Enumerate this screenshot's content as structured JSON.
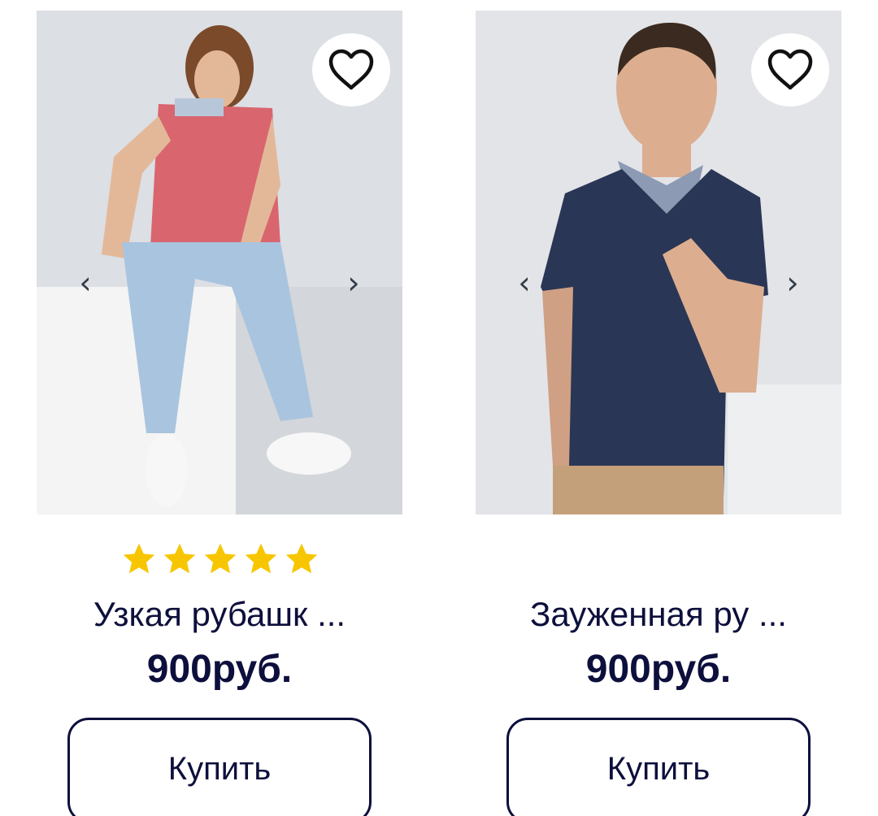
{
  "products": [
    {
      "title": "Узкая рубашк ...",
      "price": "900руб.",
      "rating": 5,
      "buy_label": "Купить",
      "photo_icon": "product-photo-pink-polo",
      "shirt_color": "#d9656e",
      "favorite_icon": "heart-outline-icon",
      "prev_icon": "‹",
      "next_icon": "›"
    },
    {
      "title": "Зауженная ру ...",
      "price": "900руб.",
      "rating": null,
      "buy_label": "Купить",
      "photo_icon": "product-photo-navy-polo",
      "shirt_color": "#2a3655",
      "favorite_icon": "heart-outline-icon",
      "prev_icon": "‹",
      "next_icon": "›"
    }
  ],
  "colors": {
    "text": "#0d0f3c",
    "star": "#f7c600",
    "photo_background": "#dfe2e6"
  }
}
